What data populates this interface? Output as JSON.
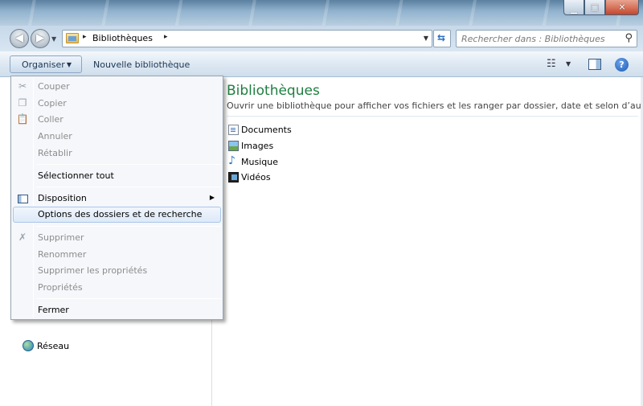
{
  "window": {
    "minimize_glyph": "▁",
    "maximize_glyph": "□",
    "close_glyph": "✕"
  },
  "nav": {
    "back_glyph": "◀",
    "forward_glyph": "▶",
    "history_dropdown_glyph": "▼"
  },
  "address": {
    "separator": "▸",
    "crumb": "Bibliothèques",
    "dropdown_glyph": "▼",
    "refresh_glyph": "⇆"
  },
  "search": {
    "placeholder": "Rechercher dans : Bibliothèques",
    "icon_glyph": "⚲"
  },
  "toolbar": {
    "organise_label": "Organiser",
    "organise_caret": "▼",
    "new_library_label": "Nouvelle bibliothèque",
    "view_glyph": "☷",
    "view_caret": "▼",
    "help_glyph": "?"
  },
  "menu": {
    "items": [
      {
        "label": "Couper",
        "enabled": false,
        "icon": "scissors-icon"
      },
      {
        "label": "Copier",
        "enabled": false,
        "icon": "copy-icon"
      },
      {
        "label": "Coller",
        "enabled": false,
        "icon": "paste-icon"
      },
      {
        "label": "Annuler",
        "enabled": false
      },
      {
        "label": "Rétablir",
        "enabled": false
      },
      {
        "label": "Sélectionner tout",
        "enabled": true
      },
      {
        "label": "Disposition",
        "enabled": true,
        "icon": "layout-icon",
        "submenu": true
      },
      {
        "label": "Options des dossiers et de recherche",
        "enabled": true,
        "highlighted": true
      },
      {
        "label": "Supprimer",
        "enabled": false,
        "icon": "delete-icon"
      },
      {
        "label": "Renommer",
        "enabled": false
      },
      {
        "label": "Supprimer les propriétés",
        "enabled": false
      },
      {
        "label": "Propriétés",
        "enabled": false
      },
      {
        "label": "Fermer",
        "enabled": true
      }
    ],
    "submenu_glyph": "▶",
    "icon_glyphs": {
      "scissors": "✂",
      "copy": "❐",
      "paste": "📋",
      "delete": "✗"
    }
  },
  "navpane": {
    "network_label": "Réseau"
  },
  "main": {
    "title": "Bibliothèques",
    "subtitle": "Ouvrir une bibliothèque pour afficher vos fichiers et les ranger par dossier, date et selon d’autres ...",
    "libraries": [
      {
        "label": "Documents",
        "icon": "document-library-icon"
      },
      {
        "label": "Images",
        "icon": "pictures-library-icon"
      },
      {
        "label": "Musique",
        "icon": "music-library-icon"
      },
      {
        "label": "Vidéos",
        "icon": "videos-library-icon"
      }
    ]
  },
  "colors": {
    "title_green": "#1e7f3f",
    "menu_highlight": "#dde9f8",
    "disabled_text": "#8d8d8d"
  }
}
